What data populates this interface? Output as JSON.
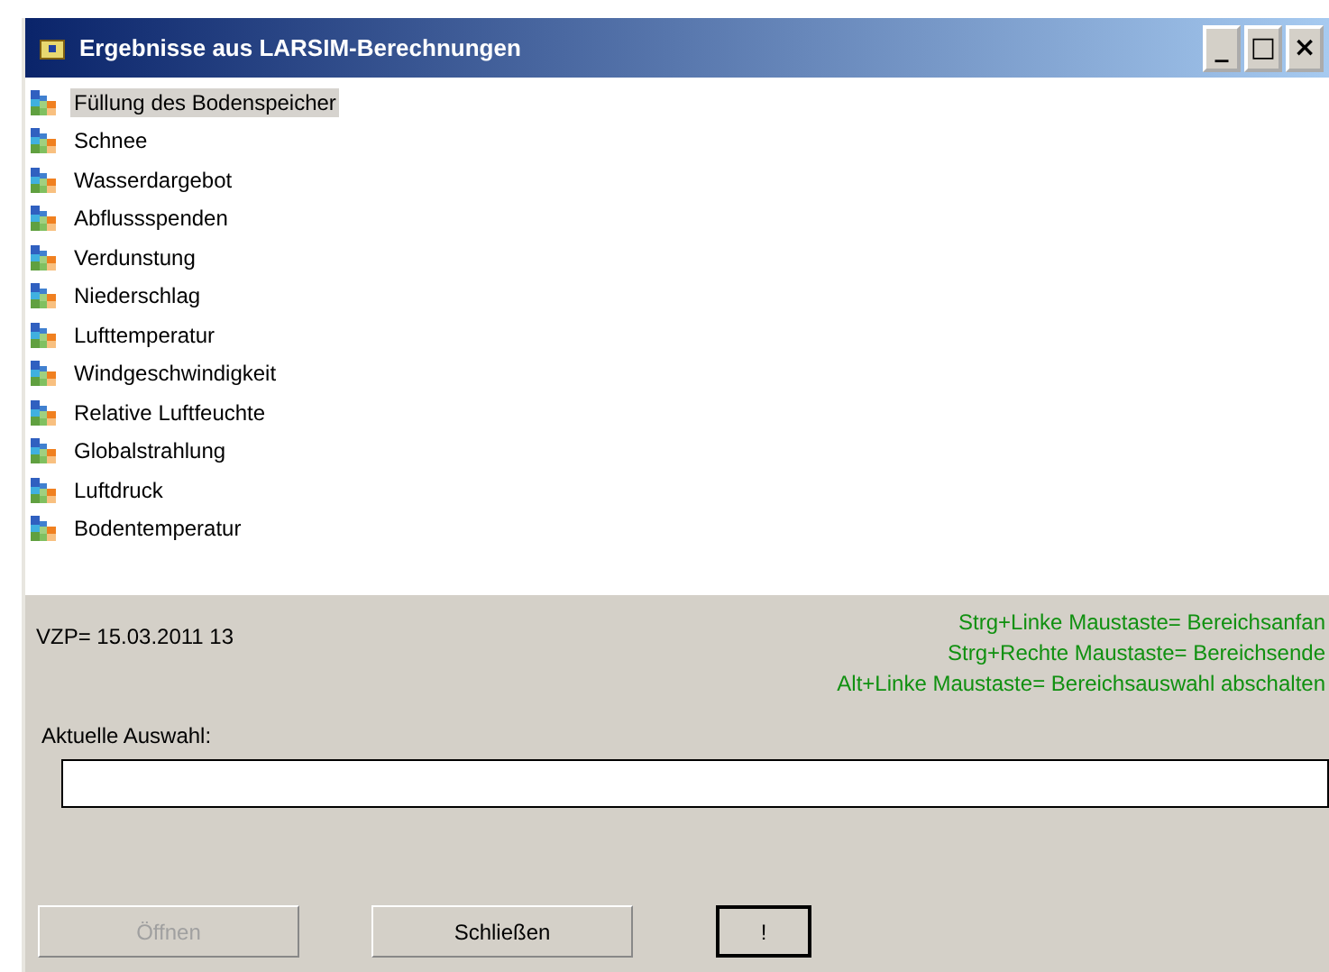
{
  "window": {
    "title": "Ergebnisse aus LARSIM-Berechnungen",
    "controls": [
      "_",
      "□",
      "×"
    ]
  },
  "list": {
    "items": [
      {
        "label": "Füllung des Bodenspeicher",
        "selected": true
      },
      {
        "label": "Schnee",
        "selected": false
      },
      {
        "label": "Wasserdargebot",
        "selected": false
      },
      {
        "label": "Abflussspenden",
        "selected": false
      },
      {
        "label": "Verdunstung",
        "selected": false
      },
      {
        "label": "Niederschlag",
        "selected": false
      },
      {
        "label": "Lufttemperatur",
        "selected": false
      },
      {
        "label": "Windgeschwindigkeit",
        "selected": false
      },
      {
        "label": "Relative Luftfeuchte",
        "selected": false
      },
      {
        "label": "Globalstrahlung",
        "selected": false
      },
      {
        "label": "Luftdruck",
        "selected": false
      },
      {
        "label": "Bodentemperatur",
        "selected": false
      }
    ]
  },
  "vzp": "VZP= 15.03.2011 13",
  "hints": [
    "Strg+Linke Maustaste= Bereichsanfan",
    "Strg+Rechte Maustaste= Bereichsende",
    "Alt+Linke Maustaste= Bereichsauswahl abschalten"
  ],
  "selection": {
    "label": "Aktuelle Auswahl:"
  },
  "buttons": [
    {
      "label": "Öffnen",
      "disabled": true,
      "focused": false
    },
    {
      "label": "Schließen",
      "disabled": false,
      "focused": false
    },
    {
      "label": "!",
      "disabled": false,
      "focused": true
    }
  ]
}
